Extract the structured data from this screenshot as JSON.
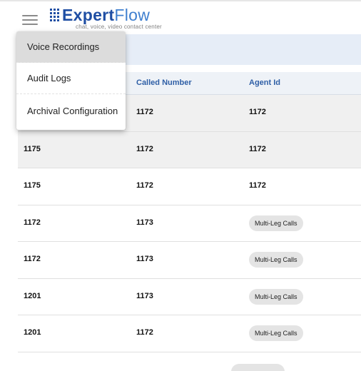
{
  "header": {
    "logo_primary": "Expert",
    "logo_secondary": "Flow",
    "logo_tagline": "chat, voice, video contact center"
  },
  "menu": {
    "items": [
      {
        "label": "Voice Recordings",
        "active": true
      },
      {
        "label": "Audit Logs",
        "active": false
      },
      {
        "label": "Archival Configuration",
        "active": false
      }
    ]
  },
  "table": {
    "columns": [
      "Called Number",
      "Agent Id"
    ],
    "rows": [
      {
        "caller": "",
        "called": "1172",
        "agent": "1172",
        "agent_is_chip": false
      },
      {
        "caller": "1175",
        "called": "1172",
        "agent": "1172",
        "agent_is_chip": false
      },
      {
        "caller": "1175",
        "called": "1172",
        "agent": "1172",
        "agent_is_chip": false
      },
      {
        "caller": "1172",
        "called": "1173",
        "agent": "Multi-Leg Calls",
        "agent_is_chip": true
      },
      {
        "caller": "1172",
        "called": "1173",
        "agent": "Multi-Leg Calls",
        "agent_is_chip": true
      },
      {
        "caller": "1201",
        "called": "1173",
        "agent": "Multi-Leg Calls",
        "agent_is_chip": true
      },
      {
        "caller": "1201",
        "called": "1172",
        "agent": "Multi-Leg Calls",
        "agent_is_chip": true
      }
    ]
  },
  "colors": {
    "brand_dark": "#1f4ea3",
    "brand_light": "#3f7fcf",
    "header_text": "#2f5fa6",
    "band": "#e6edf7"
  }
}
